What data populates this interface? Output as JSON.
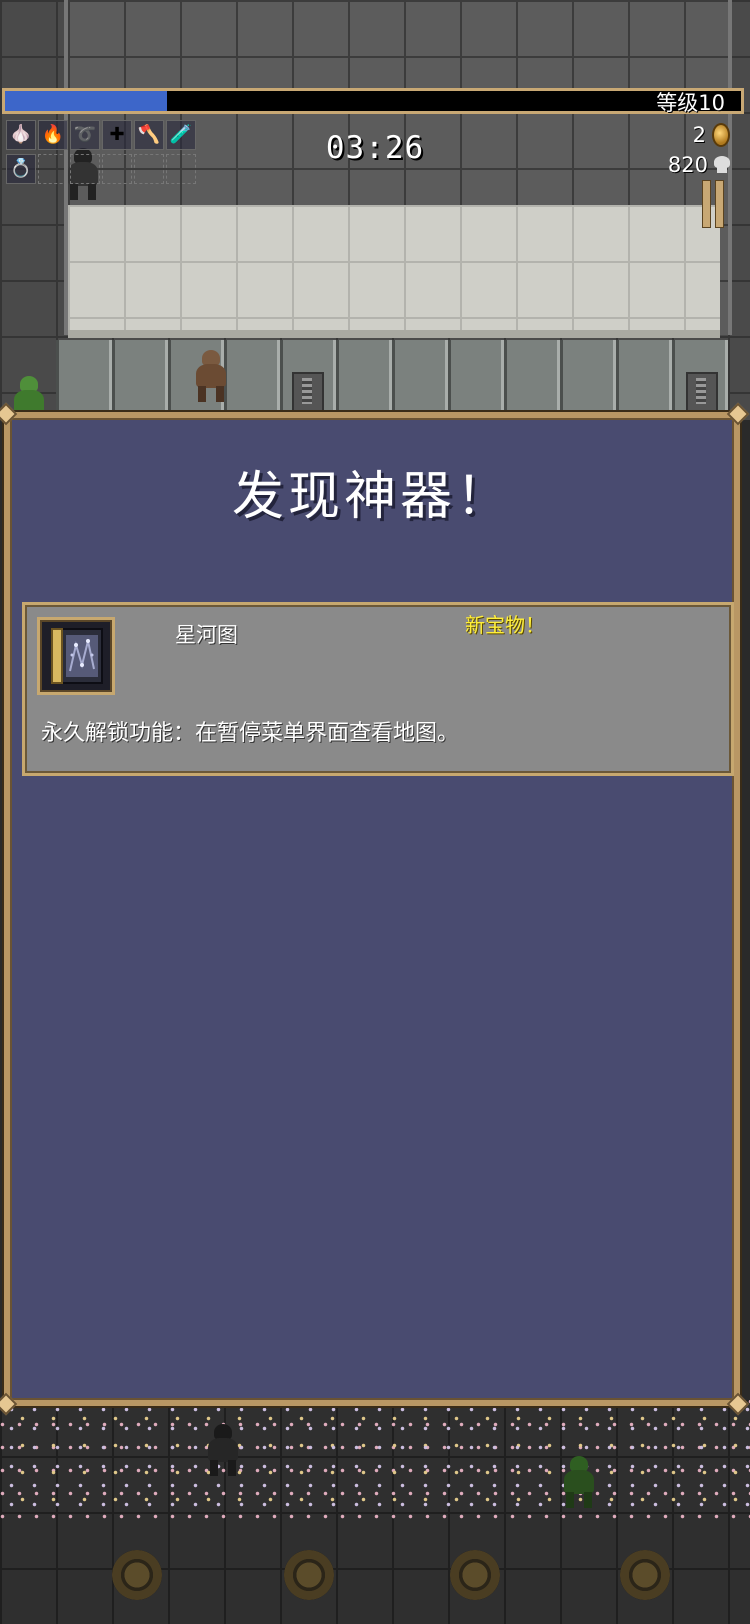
{
  "hud": {
    "level_text": "等级10",
    "xp_progress": 0.22,
    "timer": "03:26",
    "coins": "2",
    "kills": "820",
    "weapon_slots": [
      {
        "icon": "garlic-icon",
        "glyph": "🧄"
      },
      {
        "icon": "fire-wand-icon",
        "glyph": "🔥"
      },
      {
        "icon": "whip-icon",
        "glyph": "➰"
      },
      {
        "icon": "cross-icon",
        "glyph": "✚"
      },
      {
        "icon": "axe-icon",
        "glyph": "🪓"
      },
      {
        "icon": "potion-icon",
        "glyph": "🧪"
      }
    ],
    "passive_slots": [
      {
        "icon": "ring-icon",
        "glyph": "💍"
      }
    ]
  },
  "popup": {
    "title": "发现神器！",
    "item": {
      "name": "星河图",
      "badge": "新宝物！",
      "description": "永久解锁功能：在暂停菜单界面查看地图。",
      "icon": "star-map-book-icon"
    }
  },
  "colors": {
    "panel_bg": "#494b70",
    "panel_border": "#b99764",
    "xp_fill": "#3d66c9",
    "new_badge": "#ffef3a",
    "card_bg": "#8a8a8a"
  }
}
